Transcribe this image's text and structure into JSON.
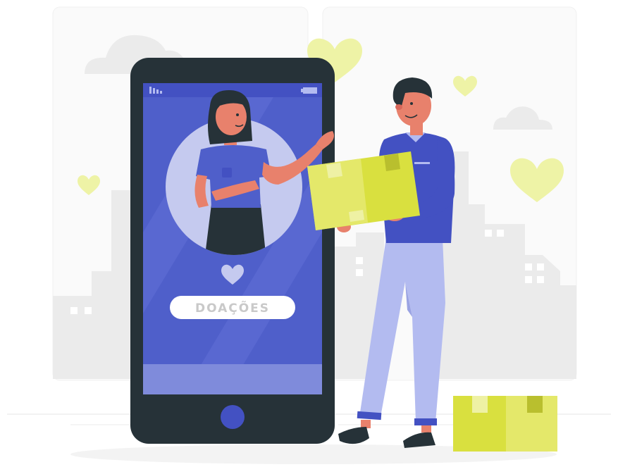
{
  "phone": {
    "button_label": "DOAÇÕES"
  },
  "colors": {
    "phone_body": "#263238",
    "screen_blue": "#4f5fca",
    "accent_blue": "#4351c2",
    "box_yellow": "#d9e03f",
    "heart_yellow": "#eef3a6",
    "background_gray": "#ebebeb",
    "skin": "#e8816c"
  },
  "icons": [
    "heart-icon",
    "signal-icon",
    "battery-icon",
    "home-button-icon",
    "cloud-icon"
  ]
}
